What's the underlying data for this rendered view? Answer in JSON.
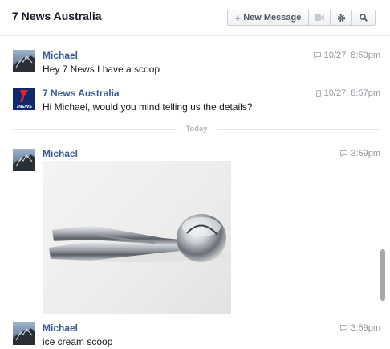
{
  "header": {
    "title": "7 News Australia",
    "new_message_label": "New Message",
    "icons": [
      "video-icon",
      "gear-icon",
      "search-icon"
    ]
  },
  "messages": [
    {
      "sender": "Michael",
      "text": "Hey 7 News I have a scoop",
      "time": "10/27, 8:50pm",
      "device": "chat-bubble-icon"
    },
    {
      "sender": "7 News Australia",
      "text": "Hi Michael, would you mind telling us the details?",
      "time": "10/27, 8:57pm",
      "device": "mobile-icon"
    },
    {
      "sender": "Michael",
      "text": "",
      "time": "3:59pm",
      "device": "chat-bubble-icon",
      "attachment": "ice cream scoop photo"
    },
    {
      "sender": "Michael",
      "text": "ice cream scoop",
      "time": "3:59pm",
      "device": "chat-bubble-icon"
    }
  ],
  "divider_label": "Today",
  "avatars": {
    "news_logo_text": "7NEWS"
  },
  "colors": {
    "name": "#3b5998",
    "text": "#141823",
    "meta": "#9197a3"
  }
}
